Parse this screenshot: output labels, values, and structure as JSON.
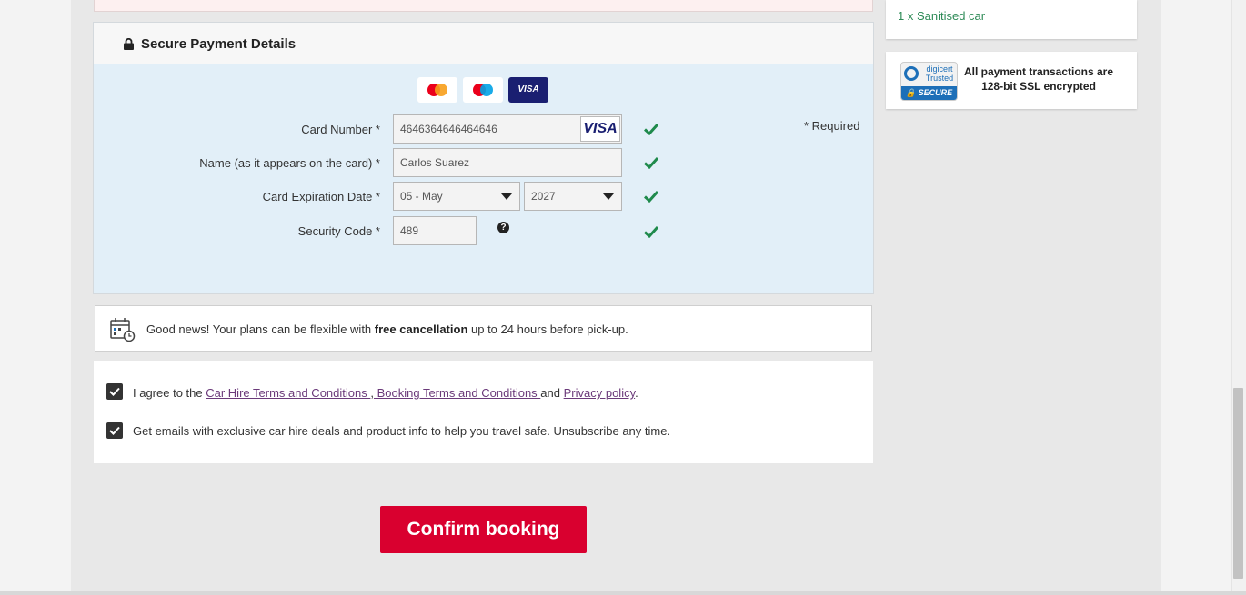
{
  "sidebar": {
    "extra_item": "1 x Sanitised car",
    "ssl_badge": {
      "brand_line1": "digicert",
      "brand_line2": "Trusted",
      "secure": "SECURE"
    },
    "ssl_text": "All payment transactions are 128-bit SSL encrypted"
  },
  "payment": {
    "title": "Secure Payment Details",
    "card_logos": [
      "mastercard",
      "maestro",
      "visa"
    ],
    "visa_label": "VISA",
    "required_note": "* Required",
    "card_number": {
      "label": "Card Number *",
      "value": "4646364646464646",
      "brand": "VISA"
    },
    "name": {
      "label": "Name (as it appears on the card) *",
      "value": "Carlos Suarez"
    },
    "expiry": {
      "label": "Card Expiration Date *",
      "month": "05 - May",
      "year": "2027"
    },
    "security_code": {
      "label": "Security Code *",
      "value": "489",
      "help": "?"
    }
  },
  "notice": {
    "prefix": "Good news! Your plans can be flexible with ",
    "bold": "free cancellation",
    "suffix": " up to 24 hours before pick-up."
  },
  "agreements": {
    "terms": {
      "prefix": "I agree to the ",
      "link1": "Car Hire Terms and Conditions ",
      "sep": ",",
      "link2": " Booking Terms and Conditions ",
      "and": "and ",
      "link3": "Privacy policy",
      "end": ".",
      "checked": true
    },
    "emails": {
      "text": "Get emails with exclusive car hire deals and product info to help you travel safe. Unsubscribe any time.",
      "checked": true
    }
  },
  "confirm_label": "Confirm booking",
  "colors": {
    "brand_red": "#d9002f",
    "check_green": "#1f8a4c",
    "panel_blue": "#e2eff8",
    "link_purple": "#6b3a7a"
  }
}
